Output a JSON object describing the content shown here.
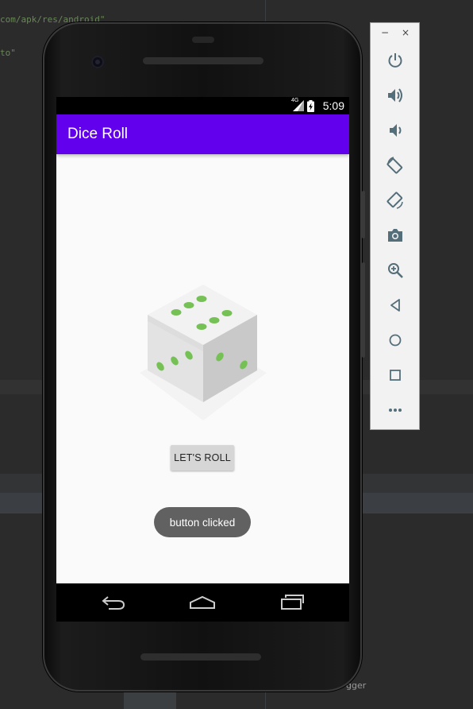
{
  "ide": {
    "code_line_1": "com/apk/res/android\"",
    "code_line_2": "to\"",
    "bottom_label": "gger"
  },
  "statusbar": {
    "network": "4G",
    "time": "5:09"
  },
  "app": {
    "title": "Dice Roll",
    "accent_color": "#6200ee",
    "dice_face": 6,
    "roll_button_label": "LET'S ROLL",
    "toast_text": "button clicked"
  },
  "navbar": {
    "buttons": [
      "back-icon",
      "home-icon",
      "recents-icon"
    ]
  },
  "emulator_panel": {
    "minimize_label": "−",
    "close_label": "×",
    "tools": [
      "power-icon",
      "volume-up-icon",
      "volume-down-icon",
      "rotate-left-icon",
      "rotate-right-icon",
      "camera-icon",
      "zoom-icon",
      "back-icon",
      "home-icon",
      "overview-icon",
      "more-icon"
    ]
  }
}
